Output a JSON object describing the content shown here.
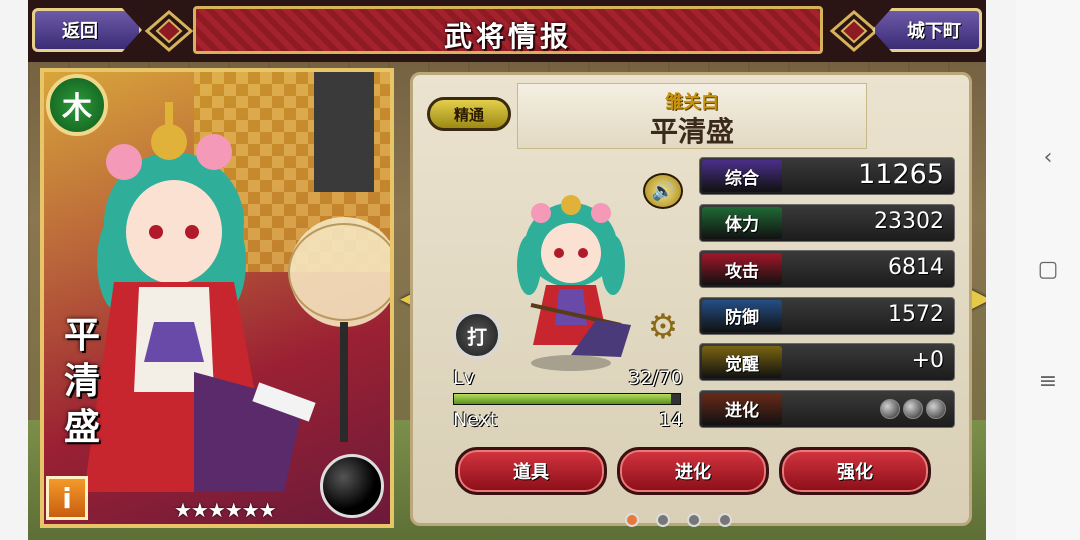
{
  "header": {
    "title": "武将情报",
    "back_label": "返回",
    "town_label": "城下町"
  },
  "card": {
    "attribute": "木",
    "name": "平清盛",
    "name_chars": [
      "平",
      "清",
      "盛"
    ],
    "stars": "★★★★★★",
    "info_label": "i"
  },
  "panel": {
    "skill_badge": "精通",
    "subtitle": "雏关白",
    "name": "平清盛",
    "attack_type": "打",
    "level_label": "Lv",
    "level_value": "32/70",
    "next_label": "Next",
    "next_value": "14",
    "xp_progress": 0.96
  },
  "stats": [
    {
      "label": "综合",
      "value": "11265",
      "color": "#4a2f8a"
    },
    {
      "label": "体力",
      "value": "23302",
      "color": "#1f6a35"
    },
    {
      "label": "攻击",
      "value": "6814",
      "color": "#a3172a"
    },
    {
      "label": "防御",
      "value": "1572",
      "color": "#244f86"
    },
    {
      "label": "觉醒",
      "value": "+0",
      "color": "#7a6410"
    },
    {
      "label": "进化",
      "value": "",
      "color": "#6a2a18"
    }
  ],
  "evolution_orbs": 3,
  "actions": {
    "items_label": "道具",
    "evolve_label": "进化",
    "enhance_label": "强化"
  },
  "pager": {
    "pages": 4,
    "active": 0
  },
  "system_nav": {
    "back_icon": "‹",
    "home_icon": "▢",
    "menu_icon": "≡"
  }
}
